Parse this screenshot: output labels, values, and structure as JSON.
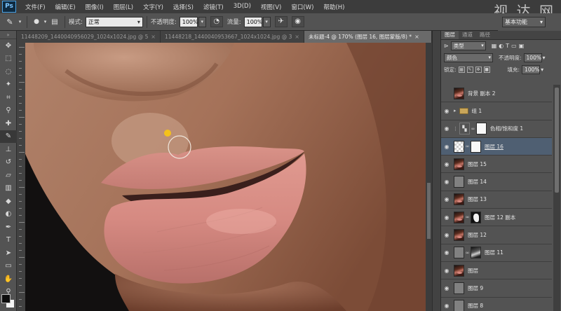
{
  "app": {
    "logo": "Ps",
    "watermark": "视 达 网"
  },
  "menu": [
    "文件(F)",
    "编辑(E)",
    "图像(I)",
    "图层(L)",
    "文字(Y)",
    "选择(S)",
    "滤镜(T)",
    "3D(D)",
    "视图(V)",
    "窗口(W)",
    "帮助(H)"
  ],
  "options": {
    "mode_label": "模式:",
    "mode_value": "正常",
    "opacity_label": "不透明度:",
    "opacity_value": "100%",
    "flow_label": "流量:",
    "flow_value": "100%",
    "preset_value": "基本功能"
  },
  "tabs": [
    {
      "label": "11448209_1440040956029_1024x1024.jpg @ 50.8...",
      "active": false
    },
    {
      "label": "11448218_1440040953667_1024x1024.jpg @ 30%...",
      "active": false
    },
    {
      "label": "未标题-4 @ 170% (图层 16, 图层蒙版/8) *",
      "active": true
    }
  ],
  "panel": {
    "tabs": [
      "图层",
      "通道",
      "路径"
    ],
    "kind_label": "类型",
    "blend_mode": "颜色",
    "opacity_label": "不透明度:",
    "opacity_value": "100%",
    "lock_label": "锁定:",
    "fill_label": "填充:",
    "fill_value": "100%",
    "layers": [
      {
        "name": "背景 副本 2",
        "thumb": "face",
        "visible": false,
        "mask": null,
        "active": false
      },
      {
        "name": "组 1",
        "thumb": "folder",
        "visible": true,
        "mask": null,
        "active": false
      },
      {
        "name": "色相/饱和度 1",
        "thumb": "adj",
        "visible": true,
        "mask": "white",
        "active": false
      },
      {
        "name": "图层 16",
        "thumb": "checker",
        "visible": true,
        "mask": "white",
        "active": true
      },
      {
        "name": "图层 15",
        "thumb": "face",
        "visible": true,
        "mask": null,
        "active": false
      },
      {
        "name": "图层 14",
        "thumb": "gray",
        "visible": true,
        "mask": null,
        "active": false
      },
      {
        "name": "图层 13",
        "thumb": "face",
        "visible": true,
        "mask": null,
        "active": false
      },
      {
        "name": "图层 12 副本",
        "thumb": "face",
        "visible": true,
        "mask": "mask",
        "active": false
      },
      {
        "name": "图层 12",
        "thumb": "face",
        "visible": true,
        "mask": null,
        "active": false
      },
      {
        "name": "图层 11",
        "thumb": "gray",
        "visible": true,
        "mask": "facegray",
        "active": false
      },
      {
        "name": "图层",
        "thumb": "face",
        "visible": true,
        "mask": null,
        "active": false
      },
      {
        "name": "图层 9",
        "thumb": "gray",
        "visible": true,
        "mask": null,
        "active": false
      },
      {
        "name": "图层 8",
        "thumb": "gray",
        "visible": true,
        "mask": null,
        "active": false
      }
    ]
  },
  "colors": {
    "accent_active_layer": "#4f5f72",
    "brush_cursor_dot": "#f4c21a"
  }
}
